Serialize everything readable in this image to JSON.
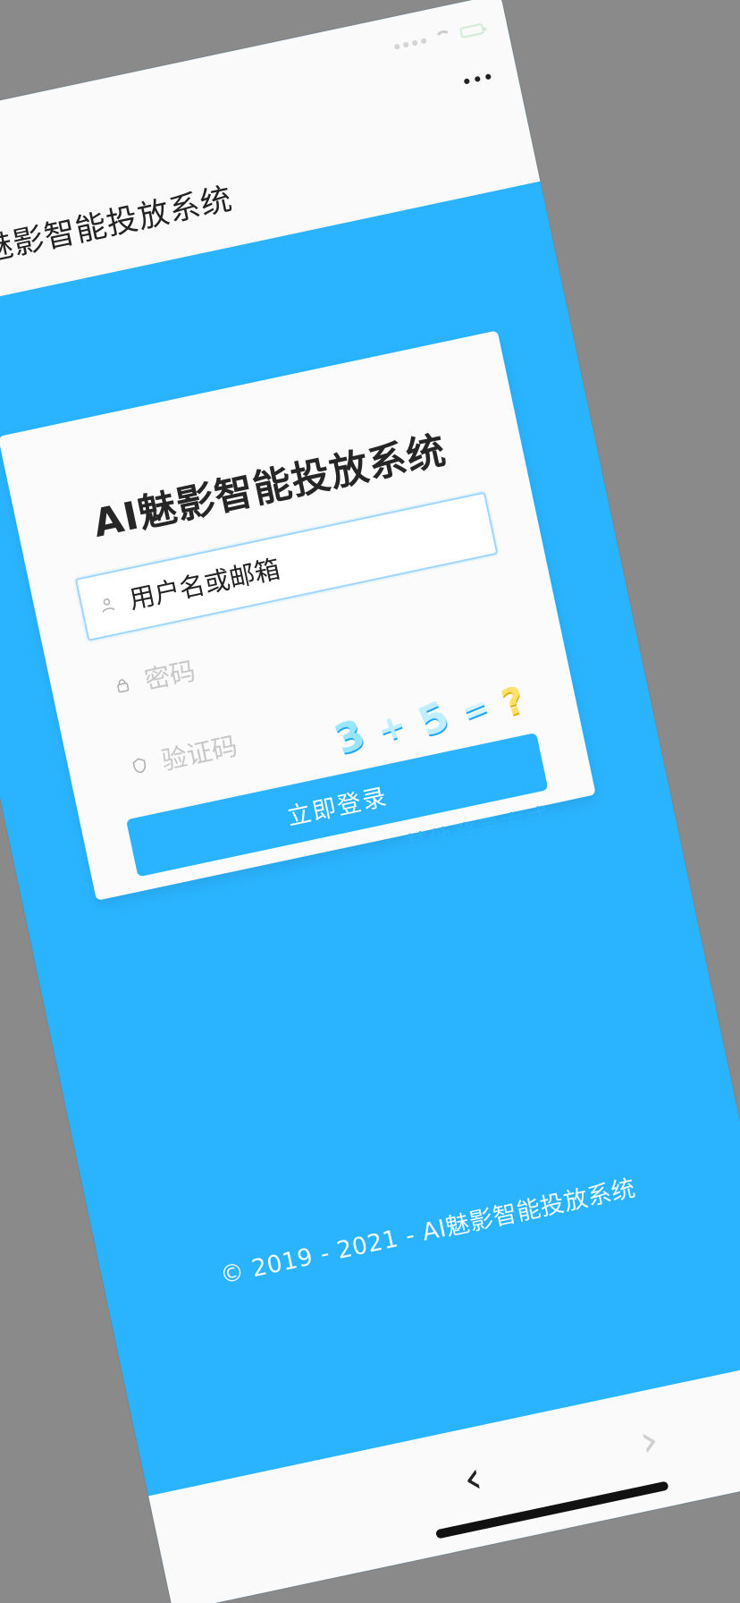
{
  "app": {
    "nav_title": "AI魅影智能投放系统"
  },
  "status_bar": {
    "icons": [
      "signal-dots-icon",
      "wifi-icon",
      "battery-icon"
    ]
  },
  "login_card": {
    "title": "AI魅影智能投放系统",
    "username_placeholder": "用户名或邮箱",
    "password_placeholder": "密码",
    "captcha_placeholder": "验证码",
    "captcha_challenge": [
      "3",
      "+",
      "5",
      "=",
      "?"
    ],
    "login_button_label": "立即登录",
    "other_login_label": "其他登录方式"
  },
  "footer": {
    "copyright": "© 2019 - 2021 - AI魅影智能投放系统"
  },
  "browser_nav": {
    "back_label": "‹",
    "forward_label": "›"
  },
  "theme": {
    "primary": "#2ab4ff",
    "background_outside": "#808080",
    "card_bg": "#fbfbfb",
    "text_dark": "#222222"
  }
}
